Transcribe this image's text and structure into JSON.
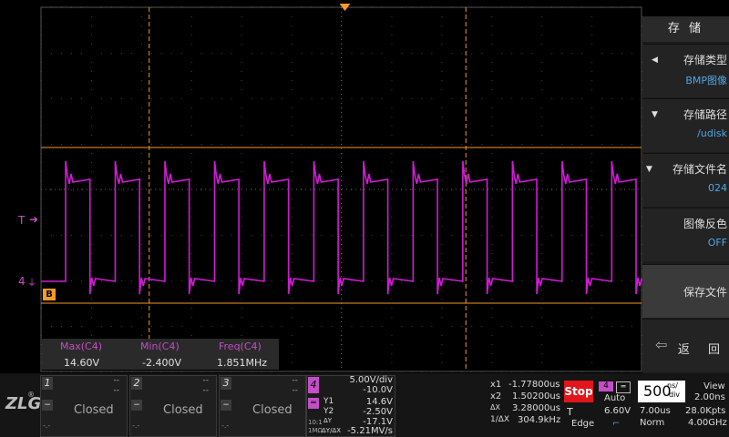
{
  "screen": {
    "trigger_marker": "T",
    "channel_marker": "4",
    "cursor_b_badge": "B"
  },
  "measurements": {
    "items": [
      {
        "label": "Max(C4)",
        "value": "14.60V"
      },
      {
        "label": "Min(C4)",
        "value": "-2.400V"
      },
      {
        "label": "Freq(C4)",
        "value": "1.851MHz"
      }
    ]
  },
  "menu": {
    "title": "存 储",
    "items": [
      {
        "label": "存储类型",
        "value": "BMP图像"
      },
      {
        "label": "存储路径",
        "value": "/udisk"
      },
      {
        "label": "存储文件名",
        "value": "024"
      },
      {
        "label": "图像反色",
        "value": "OFF"
      },
      {
        "label": "保存文件",
        "value": ""
      },
      {
        "label": "返 回",
        "value": ""
      }
    ]
  },
  "channels": [
    {
      "num": "1",
      "status": "Closed",
      "dash1": "--",
      "dash2": "--",
      "foot": "-.-"
    },
    {
      "num": "2",
      "status": "Closed",
      "dash1": "--",
      "dash2": "--",
      "foot": "-.-"
    },
    {
      "num": "3",
      "status": "Closed",
      "dash1": "--",
      "dash2": "--",
      "foot": "-.-"
    }
  ],
  "ch4": {
    "num": "4",
    "scale": "5.00V/div",
    "offset": "-10.0V",
    "y1_label": "Y1",
    "y1": "14.6V",
    "y2_label": "Y2",
    "y2": "-2.50V",
    "dy_label": "ΔY",
    "dy": "-17.1V",
    "dydx_label": "ΔY/ΔX",
    "dydx": "-5.21MV/s",
    "impedance": "1MΩ",
    "bw": "10:1"
  },
  "cursors": {
    "x1_label": "x1",
    "x1": "-1.77800us",
    "x2_label": "x2",
    "x2": "1.50200us",
    "dx_label": "ΔX",
    "dx": "3.28000us",
    "inv_label": "1/ΔX",
    "inv": "304.9kHz"
  },
  "acq": {
    "state": "Stop",
    "trig_ch": "4",
    "trig_mode": "Auto",
    "trig_label": "T",
    "trig_level": "6.60V",
    "trig_type": "Edge"
  },
  "timebase": {
    "value": "500",
    "unit_top": "ns/",
    "unit_bot": "div",
    "delay": "7.00us",
    "mode": "Norm",
    "view_label": "View",
    "view_value": "2.00ns",
    "points": "28.0Kpts",
    "rate": "4.00GHz"
  },
  "colors": {
    "trace": "#d21ad6",
    "cursor": "#f39a28",
    "accent_red": "#e0161b"
  }
}
